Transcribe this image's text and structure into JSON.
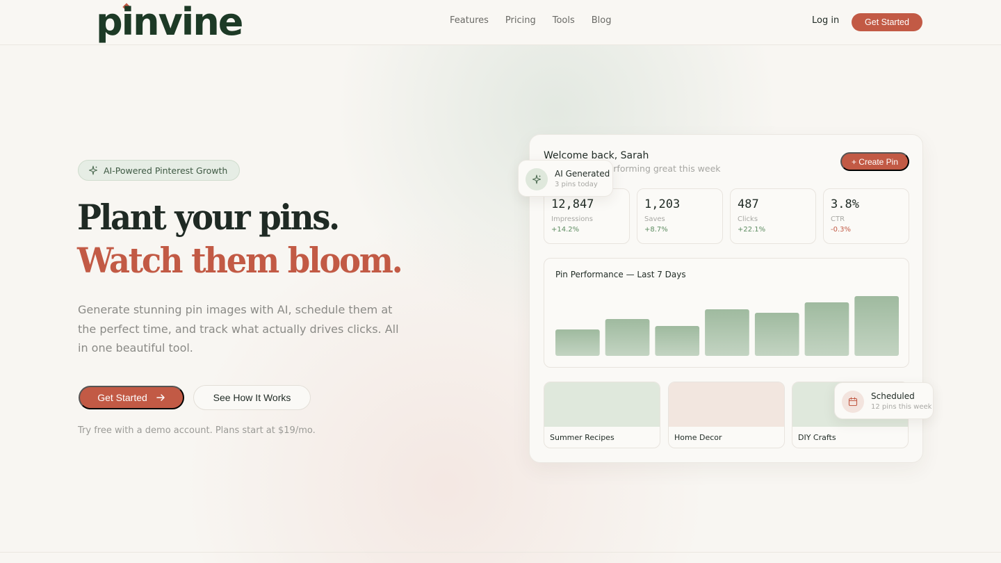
{
  "nav": {
    "logo": "pinvine",
    "links": [
      "Features",
      "Pricing",
      "Tools",
      "Blog"
    ],
    "login": "Log in",
    "cta": "Get Started"
  },
  "hero": {
    "badge": "AI-Powered Pinterest Growth",
    "headline_1": "Plant your pins.",
    "headline_2": "Watch them bloom.",
    "lede": "Generate stunning pin images with AI, schedule them at the perfect time, and track what actually drives clicks. All in one beautiful tool.",
    "primary_cta": "Get Started",
    "secondary_cta": "See How It Works",
    "note": "Try free with a demo account. Plans start at $19/mo."
  },
  "dashboard": {
    "welcome": "Welcome back, Sarah",
    "subtitle": "Your pins are performing great this week",
    "create_button": "+ Create Pin",
    "stats": [
      {
        "value": "12,847",
        "label": "Impressions",
        "change": "+14.2%",
        "trend": "up"
      },
      {
        "value": "1,203",
        "label": "Saves",
        "change": "+8.7%",
        "trend": "up"
      },
      {
        "value": "487",
        "label": "Clicks",
        "change": "+22.1%",
        "trend": "up"
      },
      {
        "value": "3.8%",
        "label": "CTR",
        "change": "-0.3%",
        "trend": "down"
      }
    ],
    "chart_title": "Pin Performance — Last 7 Days",
    "boards": [
      {
        "label": "Summer Recipes",
        "color": "#dfe8dc"
      },
      {
        "label": "Home Decor",
        "color": "#f2e6df"
      },
      {
        "label": "DIY Crafts",
        "color": "#dfe8dc"
      }
    ]
  },
  "chart_data": {
    "type": "bar",
    "title": "Pin Performance — Last 7 Days",
    "values": [
      38,
      53,
      43,
      67,
      62,
      77,
      86
    ],
    "ylim": [
      0,
      100
    ],
    "bar_color": "#9fba9f"
  },
  "floats": {
    "ai_title": "AI Generated",
    "ai_sub": "3 pins today",
    "sched_title": "Scheduled",
    "sched_sub": "12 pins this week"
  },
  "colors": {
    "accent": "#c25a45",
    "brand_green": "#1d3a26",
    "positive": "#5d8c61"
  }
}
